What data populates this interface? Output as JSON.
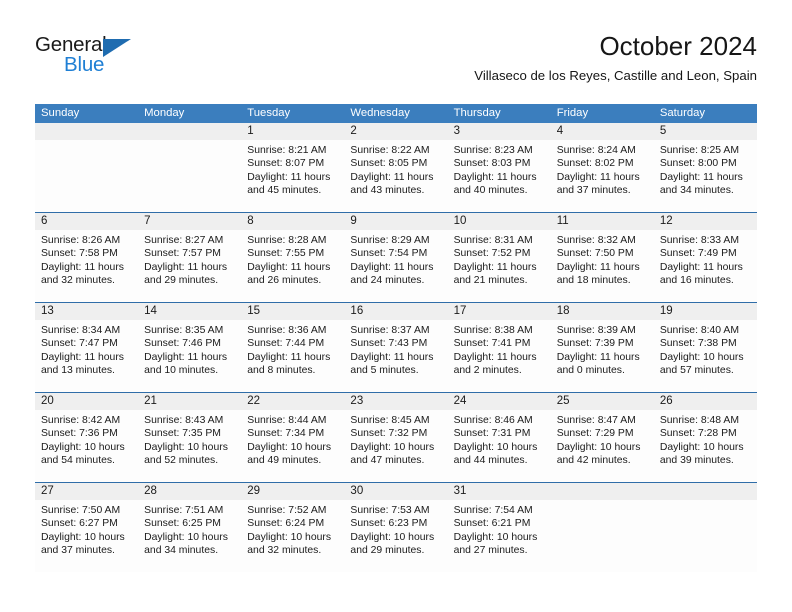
{
  "brand": {
    "name_top": "General",
    "name_bottom": "Blue",
    "triangle_color": "#1f6cb0",
    "blue_text_color": "#1f7fd4"
  },
  "header": {
    "month_title": "October 2024",
    "location": "Villaseco de los Reyes, Castille and Leon, Spain"
  },
  "colors": {
    "header_bar": "#3b7ebe",
    "week_separator": "#2f6da8",
    "daynum_band": "#efefef",
    "cell_background": "#fdfdfd",
    "text": "#1b1b1b"
  },
  "weekdays": [
    "Sunday",
    "Monday",
    "Tuesday",
    "Wednesday",
    "Thursday",
    "Friday",
    "Saturday"
  ],
  "weeks": [
    [
      {
        "day": "",
        "lines": []
      },
      {
        "day": "",
        "lines": []
      },
      {
        "day": "1",
        "lines": [
          "Sunrise: 8:21 AM",
          "Sunset: 8:07 PM",
          "Daylight: 11 hours",
          "and 45 minutes."
        ]
      },
      {
        "day": "2",
        "lines": [
          "Sunrise: 8:22 AM",
          "Sunset: 8:05 PM",
          "Daylight: 11 hours",
          "and 43 minutes."
        ]
      },
      {
        "day": "3",
        "lines": [
          "Sunrise: 8:23 AM",
          "Sunset: 8:03 PM",
          "Daylight: 11 hours",
          "and 40 minutes."
        ]
      },
      {
        "day": "4",
        "lines": [
          "Sunrise: 8:24 AM",
          "Sunset: 8:02 PM",
          "Daylight: 11 hours",
          "and 37 minutes."
        ]
      },
      {
        "day": "5",
        "lines": [
          "Sunrise: 8:25 AM",
          "Sunset: 8:00 PM",
          "Daylight: 11 hours",
          "and 34 minutes."
        ]
      }
    ],
    [
      {
        "day": "6",
        "lines": [
          "Sunrise: 8:26 AM",
          "Sunset: 7:58 PM",
          "Daylight: 11 hours",
          "and 32 minutes."
        ]
      },
      {
        "day": "7",
        "lines": [
          "Sunrise: 8:27 AM",
          "Sunset: 7:57 PM",
          "Daylight: 11 hours",
          "and 29 minutes."
        ]
      },
      {
        "day": "8",
        "lines": [
          "Sunrise: 8:28 AM",
          "Sunset: 7:55 PM",
          "Daylight: 11 hours",
          "and 26 minutes."
        ]
      },
      {
        "day": "9",
        "lines": [
          "Sunrise: 8:29 AM",
          "Sunset: 7:54 PM",
          "Daylight: 11 hours",
          "and 24 minutes."
        ]
      },
      {
        "day": "10",
        "lines": [
          "Sunrise: 8:31 AM",
          "Sunset: 7:52 PM",
          "Daylight: 11 hours",
          "and 21 minutes."
        ]
      },
      {
        "day": "11",
        "lines": [
          "Sunrise: 8:32 AM",
          "Sunset: 7:50 PM",
          "Daylight: 11 hours",
          "and 18 minutes."
        ]
      },
      {
        "day": "12",
        "lines": [
          "Sunrise: 8:33 AM",
          "Sunset: 7:49 PM",
          "Daylight: 11 hours",
          "and 16 minutes."
        ]
      }
    ],
    [
      {
        "day": "13",
        "lines": [
          "Sunrise: 8:34 AM",
          "Sunset: 7:47 PM",
          "Daylight: 11 hours",
          "and 13 minutes."
        ]
      },
      {
        "day": "14",
        "lines": [
          "Sunrise: 8:35 AM",
          "Sunset: 7:46 PM",
          "Daylight: 11 hours",
          "and 10 minutes."
        ]
      },
      {
        "day": "15",
        "lines": [
          "Sunrise: 8:36 AM",
          "Sunset: 7:44 PM",
          "Daylight: 11 hours",
          "and 8 minutes."
        ]
      },
      {
        "day": "16",
        "lines": [
          "Sunrise: 8:37 AM",
          "Sunset: 7:43 PM",
          "Daylight: 11 hours",
          "and 5 minutes."
        ]
      },
      {
        "day": "17",
        "lines": [
          "Sunrise: 8:38 AM",
          "Sunset: 7:41 PM",
          "Daylight: 11 hours",
          "and 2 minutes."
        ]
      },
      {
        "day": "18",
        "lines": [
          "Sunrise: 8:39 AM",
          "Sunset: 7:39 PM",
          "Daylight: 11 hours",
          "and 0 minutes."
        ]
      },
      {
        "day": "19",
        "lines": [
          "Sunrise: 8:40 AM",
          "Sunset: 7:38 PM",
          "Daylight: 10 hours",
          "and 57 minutes."
        ]
      }
    ],
    [
      {
        "day": "20",
        "lines": [
          "Sunrise: 8:42 AM",
          "Sunset: 7:36 PM",
          "Daylight: 10 hours",
          "and 54 minutes."
        ]
      },
      {
        "day": "21",
        "lines": [
          "Sunrise: 8:43 AM",
          "Sunset: 7:35 PM",
          "Daylight: 10 hours",
          "and 52 minutes."
        ]
      },
      {
        "day": "22",
        "lines": [
          "Sunrise: 8:44 AM",
          "Sunset: 7:34 PM",
          "Daylight: 10 hours",
          "and 49 minutes."
        ]
      },
      {
        "day": "23",
        "lines": [
          "Sunrise: 8:45 AM",
          "Sunset: 7:32 PM",
          "Daylight: 10 hours",
          "and 47 minutes."
        ]
      },
      {
        "day": "24",
        "lines": [
          "Sunrise: 8:46 AM",
          "Sunset: 7:31 PM",
          "Daylight: 10 hours",
          "and 44 minutes."
        ]
      },
      {
        "day": "25",
        "lines": [
          "Sunrise: 8:47 AM",
          "Sunset: 7:29 PM",
          "Daylight: 10 hours",
          "and 42 minutes."
        ]
      },
      {
        "day": "26",
        "lines": [
          "Sunrise: 8:48 AM",
          "Sunset: 7:28 PM",
          "Daylight: 10 hours",
          "and 39 minutes."
        ]
      }
    ],
    [
      {
        "day": "27",
        "lines": [
          "Sunrise: 7:50 AM",
          "Sunset: 6:27 PM",
          "Daylight: 10 hours",
          "and 37 minutes."
        ]
      },
      {
        "day": "28",
        "lines": [
          "Sunrise: 7:51 AM",
          "Sunset: 6:25 PM",
          "Daylight: 10 hours",
          "and 34 minutes."
        ]
      },
      {
        "day": "29",
        "lines": [
          "Sunrise: 7:52 AM",
          "Sunset: 6:24 PM",
          "Daylight: 10 hours",
          "and 32 minutes."
        ]
      },
      {
        "day": "30",
        "lines": [
          "Sunrise: 7:53 AM",
          "Sunset: 6:23 PM",
          "Daylight: 10 hours",
          "and 29 minutes."
        ]
      },
      {
        "day": "31",
        "lines": [
          "Sunrise: 7:54 AM",
          "Sunset: 6:21 PM",
          "Daylight: 10 hours",
          "and 27 minutes."
        ]
      },
      {
        "day": "",
        "lines": []
      },
      {
        "day": "",
        "lines": []
      }
    ]
  ]
}
